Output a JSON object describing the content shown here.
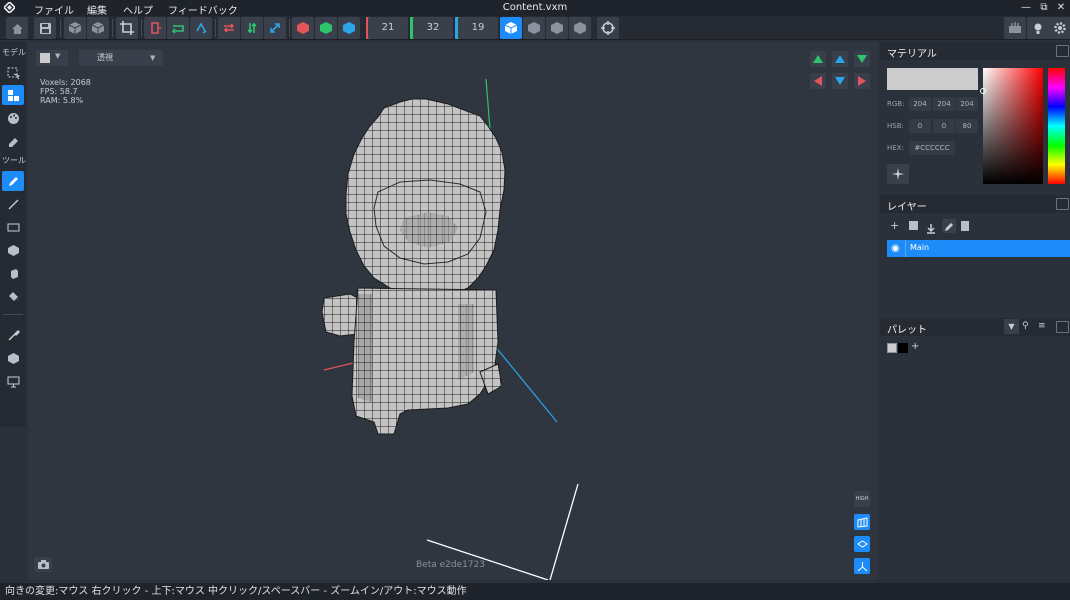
{
  "app": {
    "title": "Content.vxm",
    "menu": [
      "ファイル",
      "編集",
      "ヘルプ",
      "フィードバック"
    ]
  },
  "toolbar": {
    "size_x": "21",
    "size_y": "32",
    "size_z": "19",
    "axis_colors": {
      "x": "#e0545a",
      "y": "#2cc46d",
      "z": "#2ba4e8"
    }
  },
  "leftbar": {
    "section_model": "モデル",
    "section_tool": "ツール"
  },
  "viewport": {
    "view_mode": "透視",
    "stats": {
      "voxels": "Voxels: 2068",
      "fps": "FPS: 58.7",
      "ram": "RAM: 5.8%"
    },
    "version": "Beta e2de1723",
    "high_label": "HIGH"
  },
  "material": {
    "title": "マテリアル",
    "rgb_label": "RGB:",
    "rgb": [
      "204",
      "204",
      "204"
    ],
    "hsb_label": "HSB:",
    "hsb": [
      "0",
      "0",
      "80"
    ],
    "hex_label": "HEX:",
    "hex": "#CCCCCC",
    "color": "#cccccc"
  },
  "layers": {
    "title": "レイヤー",
    "items": [
      {
        "name": "Main",
        "active": true
      }
    ]
  },
  "palette": {
    "title": "パレット",
    "swatches": [
      "#cccccc",
      "#000000"
    ],
    "add": "+"
  },
  "status": {
    "hint": "向きの変更:マウス 右クリック - 上下:マウス 中クリック/スペースバー - ズームイン/アウト:マウス動作"
  }
}
